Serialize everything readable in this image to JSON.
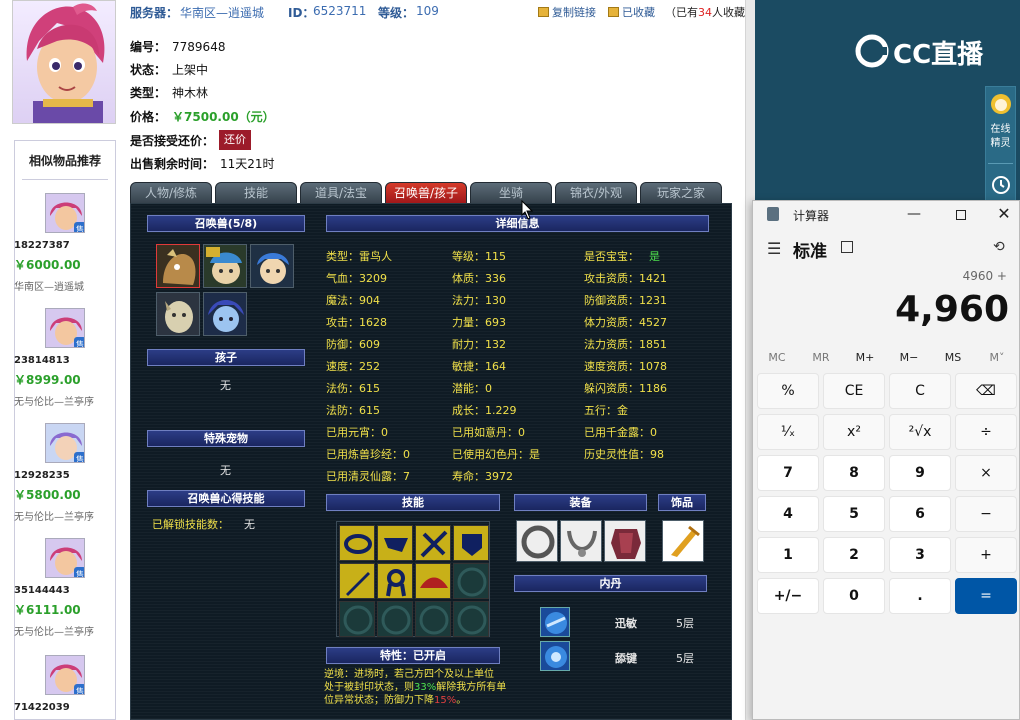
{
  "header": {
    "server_label": "服务器：",
    "server_value": "华南区—逍遥城",
    "id_label": "ID：",
    "id_value": "6523711",
    "level_label": "等级：",
    "level_value": "109",
    "copy_link": "复制链接",
    "favorited": "已收藏",
    "fav_count_pre": "（已有",
    "fav_count": "34",
    "fav_count_post": "人收藏）"
  },
  "item": {
    "no_label": "编号：",
    "no_value": "7789648",
    "status_label": "状态：",
    "status_value": "上架中",
    "type_label": "类型：",
    "type_value": "神木林",
    "price_label": "价格：",
    "price_value": "￥7500.00（元）",
    "bargain_label": "是否接受还价：",
    "bargain_button": "还价",
    "remain_label": "出售剩余时间：",
    "remain_value": "11天21时"
  },
  "recommend": {
    "title": "相似物品推荐",
    "items": [
      {
        "id": "18227387",
        "price": "￥6000.00",
        "server": "华南区—逍遥城"
      },
      {
        "id": "23814813",
        "price": "￥8999.00",
        "server": "无与伦比—兰亭序"
      },
      {
        "id": "12928235",
        "price": "￥5800.00",
        "server": "无与伦比—兰亭序"
      },
      {
        "id": "35144443",
        "price": "￥6111.00",
        "server": "无与伦比—兰亭序"
      },
      {
        "id": "71422039"
      }
    ],
    "sale_badge": "售"
  },
  "tabs": [
    "人物/修炼",
    "技能",
    "道具/法宝",
    "召唤兽/孩子",
    "坐骑",
    "锦衣/外观",
    "玩家之家"
  ],
  "pet": {
    "summon_header": "召唤兽(5/8)",
    "child_header": "孩子",
    "child_value": "无",
    "special_header": "特殊宠物",
    "special_value": "无",
    "skill_header": "召唤兽心得技能",
    "unlocked_label": "已解锁技能数：",
    "unlocked_value": "无",
    "detail_header": "详细信息",
    "stats": [
      [
        "类型：雷鸟人",
        "等级：115",
        "是否宝宝："
      ],
      [
        "气血：3209",
        "体质：336",
        "攻击资质：1421"
      ],
      [
        "魔法：904",
        "法力：130",
        "防御资质：1231"
      ],
      [
        "攻击：1628",
        "力量：693",
        "体力资质：4527"
      ],
      [
        "防御：609",
        "耐力：132",
        "法力资质：1851"
      ],
      [
        "速度：252",
        "敏捷：164",
        "速度资质：1078"
      ],
      [
        "法伤：615",
        "潜能：0",
        "躲闪资质：1186"
      ],
      [
        "法防：615",
        "成长：1.229",
        "五行：金"
      ],
      [
        "已用元宵：0",
        "已用如意丹：0",
        "已用千金露：0"
      ],
      [
        "已用炼兽珍经：0",
        "已使用幻色丹：是",
        "历史灵性值：98"
      ],
      [
        "已用清灵仙露：7",
        "寿命：3972",
        ""
      ]
    ],
    "baby_value": "是",
    "skills_header": "技能",
    "equip_header": "装备",
    "ornament_header": "饰品",
    "neidan_header": "内丹",
    "neidan": [
      {
        "name": "迅敏",
        "level": "5层"
      },
      {
        "name": "舔键",
        "level": "5层"
      }
    ],
    "trait_header": "特性：已开启",
    "trait_text_1": "逆境：进场时，若己方四个及以上单位",
    "trait_text_2": "处于被封印状态，则",
    "trait_pct_1": "33%",
    "trait_text_3": "解除我方所有单",
    "trait_text_4": "位异常状态；防御力下降",
    "trait_pct_2": "15%",
    "trait_text_5": "。"
  },
  "cc": {
    "logo": "CC直播",
    "widget_1": "在线精灵"
  },
  "calculator": {
    "app_title": "计算器",
    "mode": "标准",
    "expression": "4960 +",
    "display": "4,960",
    "memory": [
      "MC",
      "MR",
      "M+",
      "M−",
      "MS",
      "M˅"
    ],
    "keys": [
      [
        "%",
        "CE",
        "C",
        "⌫"
      ],
      [
        "¹⁄ₓ",
        "x²",
        "²√x",
        "÷"
      ],
      [
        "7",
        "8",
        "9",
        "×"
      ],
      [
        "4",
        "5",
        "6",
        "−"
      ],
      [
        "1",
        "2",
        "3",
        "+"
      ],
      [
        "+/−",
        "0",
        ".",
        "="
      ]
    ]
  }
}
